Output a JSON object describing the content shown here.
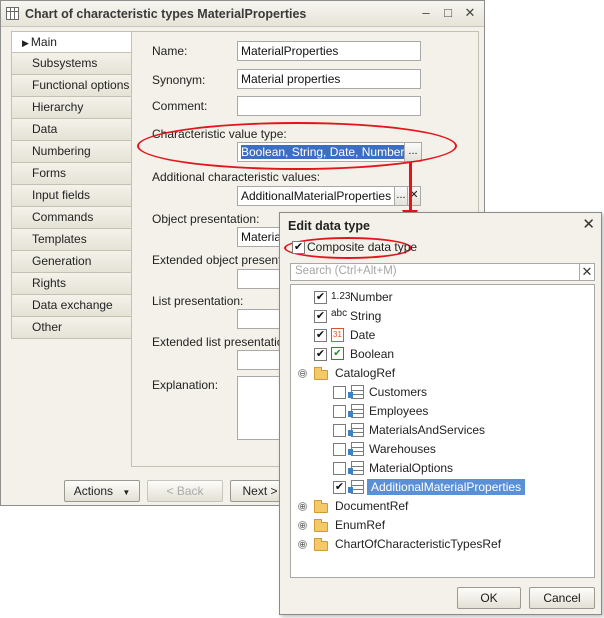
{
  "window": {
    "title": "Chart of characteristic types MaterialProperties",
    "minimize": "–",
    "maximize": "□",
    "close": "✕"
  },
  "tabs": [
    {
      "label": "Main"
    },
    {
      "label": "Subsystems"
    },
    {
      "label": "Functional options"
    },
    {
      "label": "Hierarchy"
    },
    {
      "label": "Data"
    },
    {
      "label": "Numbering"
    },
    {
      "label": "Forms"
    },
    {
      "label": "Input fields"
    },
    {
      "label": "Commands"
    },
    {
      "label": "Templates"
    },
    {
      "label": "Generation"
    },
    {
      "label": "Rights"
    },
    {
      "label": "Data exchange"
    },
    {
      "label": "Other"
    }
  ],
  "form": {
    "name_label": "Name:",
    "name_value": "MaterialProperties",
    "synonym_label": "Synonym:",
    "synonym_value": "Material properties",
    "comment_label": "Comment:",
    "comment_value": "",
    "char_type_label": "Characteristic value type:",
    "char_type_value": "Boolean, String, Date, Number, Cat",
    "char_type_btn": "...",
    "additional_label": "Additional characteristic values:",
    "additional_value": "AdditionalMaterialProperties",
    "additional_btn": "...",
    "additional_clear": "✕",
    "object_pres_label": "Object presentation:",
    "object_pres_value": "Material",
    "ext_object_pres_label": "Extended object presentation:",
    "list_pres_label": "List presentation:",
    "ext_list_pres_label": "Extended list presentation:",
    "explanation_label": "Explanation:"
  },
  "bottom": {
    "actions": "Actions",
    "back": "< Back",
    "next": "Next >"
  },
  "dialog": {
    "title": "Edit data type",
    "close": "✕",
    "composite_label": "Composite data type",
    "composite_checked": "✔",
    "search_placeholder": "Search (Ctrl+Alt+M)",
    "search_clear": "✕",
    "primitives": [
      {
        "label": "Number",
        "icon": "1.23",
        "checked": "✔"
      },
      {
        "label": "String",
        "icon": "abc",
        "checked": "✔"
      },
      {
        "label": "Date",
        "icon": "31",
        "checked": "✔"
      },
      {
        "label": "Boolean",
        "icon": "✔",
        "checked": "✔"
      }
    ],
    "catalog_ref": {
      "label": "CatalogRef",
      "expander": "⊖",
      "items": [
        {
          "label": "Customers",
          "checked": ""
        },
        {
          "label": "Employees",
          "checked": ""
        },
        {
          "label": "MaterialsAndServices",
          "checked": ""
        },
        {
          "label": "Warehouses",
          "checked": ""
        },
        {
          "label": "MaterialOptions",
          "checked": ""
        },
        {
          "label": "AdditionalMaterialProperties",
          "checked": "✔"
        }
      ]
    },
    "other_groups": [
      {
        "label": "DocumentRef",
        "expander": "⊕"
      },
      {
        "label": "EnumRef",
        "expander": "⊕"
      },
      {
        "label": "ChartOfCharacteristicTypesRef",
        "expander": "⊕"
      }
    ],
    "ok": "OK",
    "cancel": "Cancel"
  },
  "colors": {
    "annotation": "#e3151b",
    "selection": "#3c6fc1"
  }
}
